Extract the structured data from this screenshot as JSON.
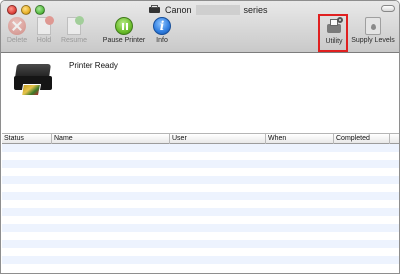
{
  "window": {
    "title_prefix": "Canon",
    "title_suffix": "series"
  },
  "toolbar": {
    "items": [
      {
        "label": "Delete",
        "icon": "delete-icon",
        "enabled": false
      },
      {
        "label": "Hold",
        "icon": "hold-icon",
        "enabled": false
      },
      {
        "label": "Resume",
        "icon": "resume-icon",
        "enabled": false
      },
      {
        "label": "Pause Printer",
        "icon": "pause-icon",
        "enabled": true
      },
      {
        "label": "Info",
        "icon": "info-icon",
        "enabled": true
      },
      {
        "label": "Utility",
        "icon": "utility-icon",
        "enabled": true
      },
      {
        "label": "Supply Levels",
        "icon": "supply-levels-icon",
        "enabled": true
      }
    ],
    "highlight_color": "#e02020"
  },
  "printer": {
    "status": "Printer Ready"
  },
  "queue": {
    "columns": [
      "Status",
      "Name",
      "User",
      "When",
      "Completed"
    ],
    "row_stripe_color": "#edf3fe",
    "rows": []
  }
}
